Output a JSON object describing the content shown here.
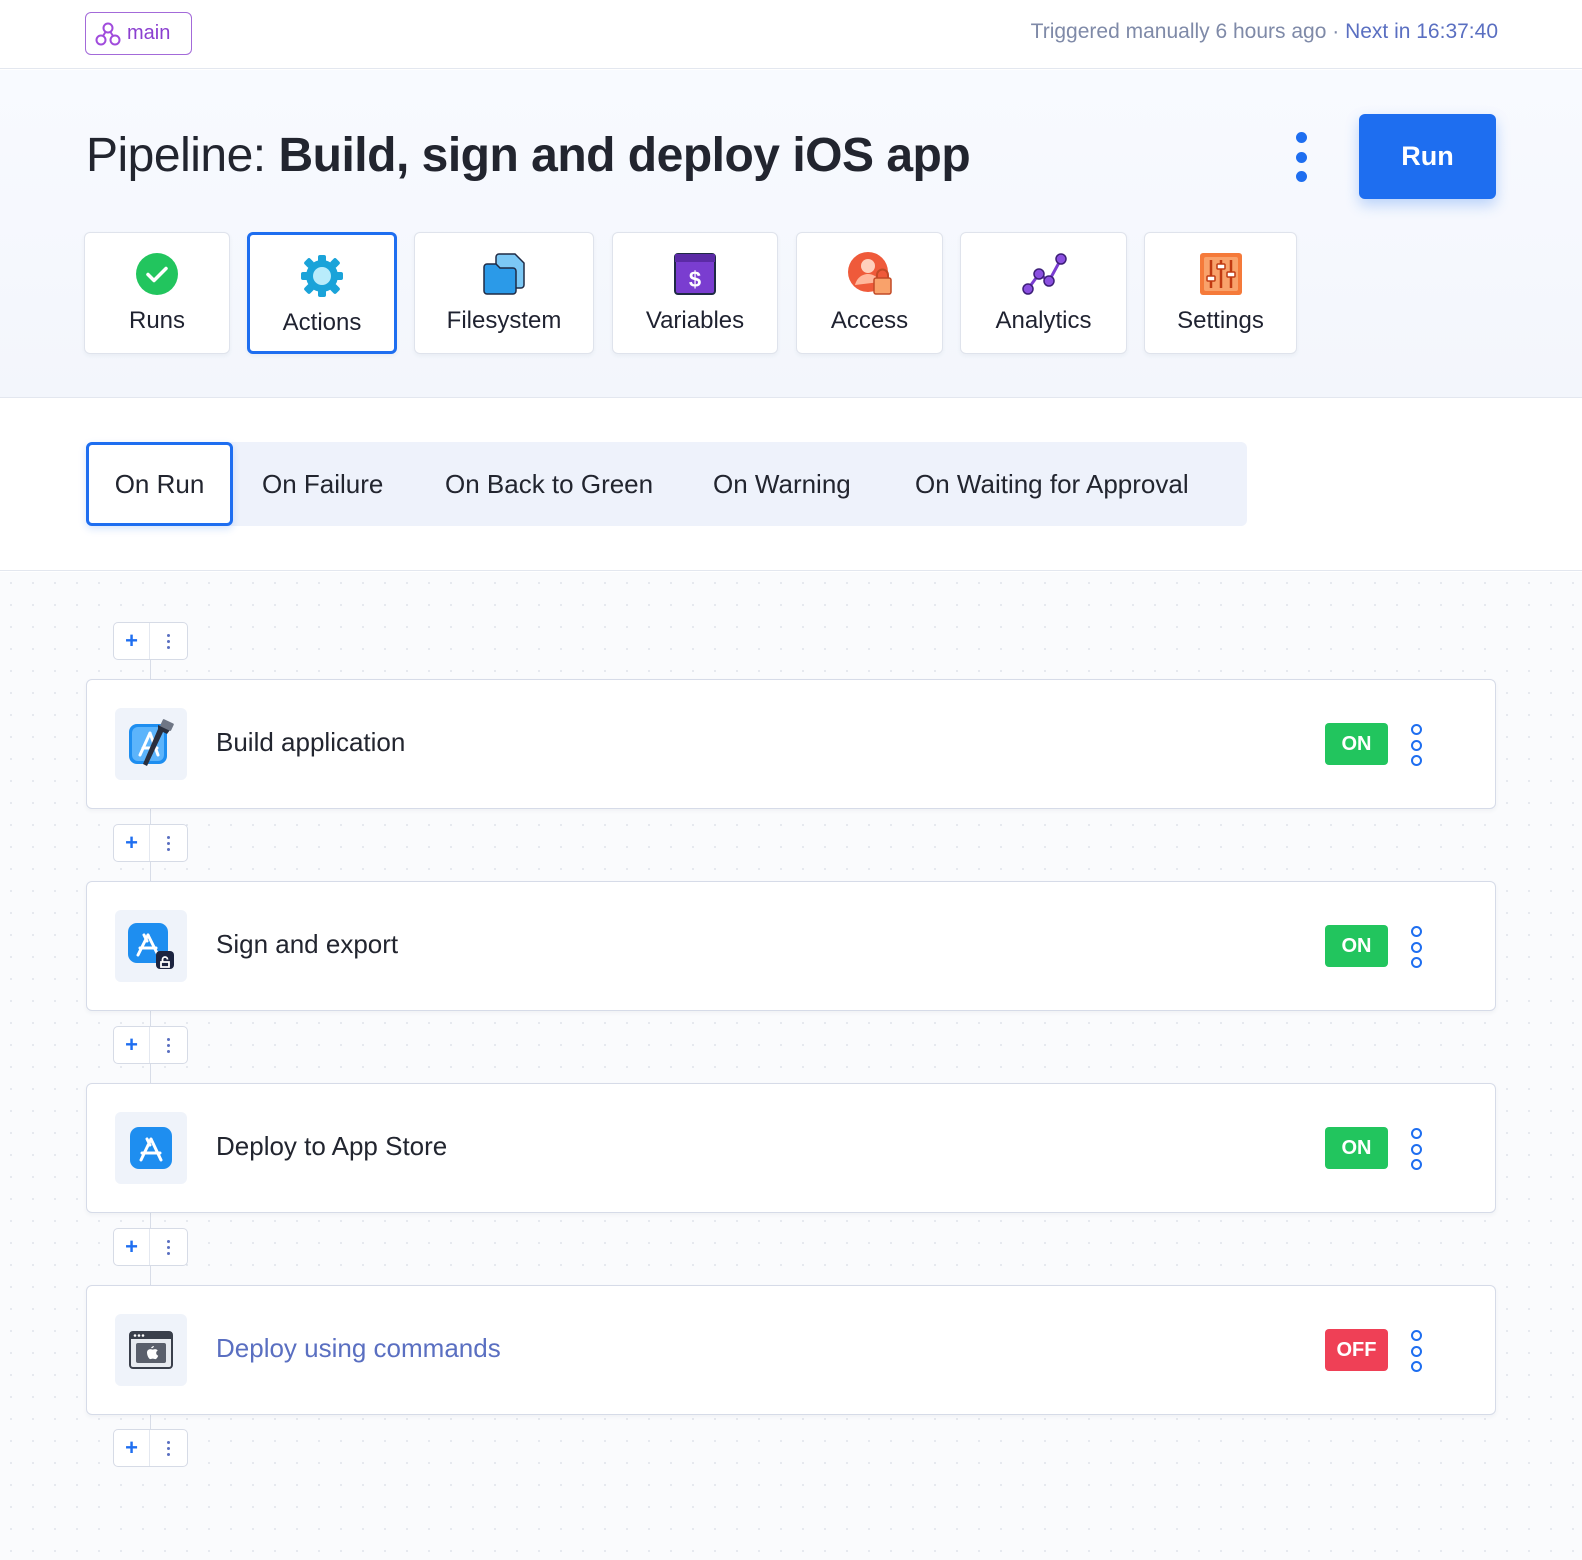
{
  "topbar": {
    "branch": "main",
    "trigger_text": "Triggered manually 6 hours ago · ",
    "next_text": "Next in 16:37:40"
  },
  "header": {
    "title_prefix": "Pipeline: ",
    "title_name": "Build, sign and deploy iOS app",
    "run_label": "Run"
  },
  "section_tabs": [
    {
      "label": "Runs",
      "icon": "check-circle-icon"
    },
    {
      "label": "Actions",
      "icon": "gear-icon",
      "active": true
    },
    {
      "label": "Filesystem",
      "icon": "files-icon"
    },
    {
      "label": "Variables",
      "icon": "dollar-icon"
    },
    {
      "label": "Access",
      "icon": "user-lock-icon"
    },
    {
      "label": "Analytics",
      "icon": "analytics-icon"
    },
    {
      "label": "Settings",
      "icon": "sliders-icon"
    }
  ],
  "trigger_tabs": [
    {
      "label": "On Run",
      "active": true
    },
    {
      "label": "On Failure"
    },
    {
      "label": "On Back to Green"
    },
    {
      "label": "On Warning"
    },
    {
      "label": "On Waiting for Approval"
    }
  ],
  "actions": [
    {
      "name": "Build application",
      "status": "ON",
      "icon": "xcode-icon"
    },
    {
      "name": "Sign and export",
      "status": "ON",
      "icon": "app-store-sign-icon"
    },
    {
      "name": "Deploy to App Store",
      "status": "ON",
      "icon": "app-store-icon"
    },
    {
      "name": "Deploy using commands",
      "status": "OFF",
      "icon": "macos-terminal-icon"
    }
  ],
  "colors": {
    "accent": "#1e6ef0",
    "on": "#22c55e",
    "off": "#ef4056",
    "branch": "#8b3fd0"
  }
}
